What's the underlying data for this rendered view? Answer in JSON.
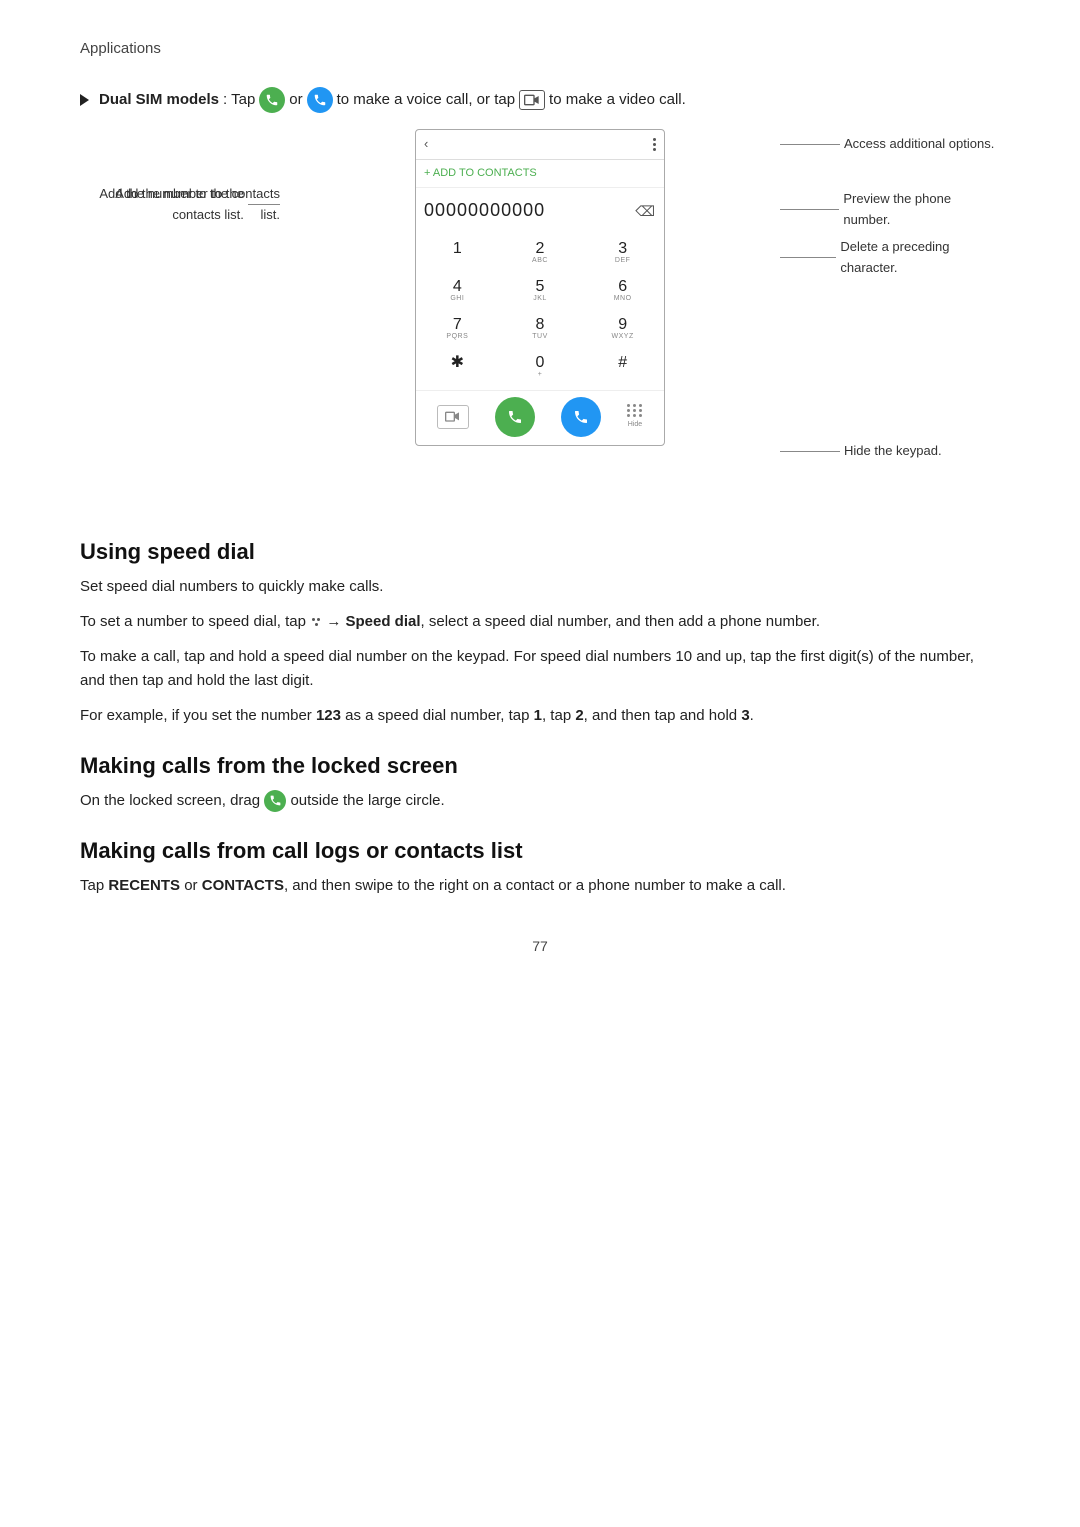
{
  "breadcrumb": "Applications",
  "dual_sim": {
    "label": "Dual SIM models",
    "text_before": ": Tap",
    "text_middle1": " or ",
    "text_middle2": " to make a voice call, or tap ",
    "text_end": " to make a video call."
  },
  "phone_ui": {
    "back_symbol": "‹",
    "menu_label": "⋮",
    "add_to_contacts_label": "+ ADD TO CONTACTS",
    "number_display": "00000000000",
    "keypad": [
      {
        "row": [
          {
            "num": "1",
            "sub": ""
          },
          {
            "num": "2",
            "sub": "ABC"
          },
          {
            "num": "3",
            "sub": "DEF"
          }
        ]
      },
      {
        "row": [
          {
            "num": "4",
            "sub": "GHI"
          },
          {
            "num": "5",
            "sub": "JKL"
          },
          {
            "num": "6",
            "sub": "MNO"
          }
        ]
      },
      {
        "row": [
          {
            "num": "7",
            "sub": "PQRS"
          },
          {
            "num": "8",
            "sub": "TUV"
          },
          {
            "num": "9",
            "sub": "WXYZ"
          }
        ]
      },
      {
        "row": [
          {
            "num": "✱",
            "sub": ""
          },
          {
            "num": "0",
            "sub": "+"
          },
          {
            "num": "#",
            "sub": ""
          }
        ]
      }
    ],
    "hide_label": "Hide"
  },
  "annotations": {
    "left_add_contacts": "Add the number to the contacts list.",
    "right_options": "Access additional options.",
    "right_preview": "Preview the phone number.",
    "right_delete": "Delete a preceding character.",
    "right_hide": "Hide the keypad."
  },
  "sections": [
    {
      "id": "speed-dial",
      "heading": "Using speed dial",
      "paragraphs": [
        "Set speed dial numbers to quickly make calls.",
        "To set a number to speed dial, tap  → Speed dial, select a speed dial number, and then add a phone number.",
        "To make a call, tap and hold a speed dial number on the keypad. For speed dial numbers 10 and up, tap the first digit(s) of the number, and then tap and hold the last digit.",
        "For example, if you set the number 123 as a speed dial number, tap 1, tap 2, and then tap and hold 3."
      ]
    },
    {
      "id": "locked-screen",
      "heading": "Making calls from the locked screen",
      "paragraphs": [
        "On the locked screen, drag  outside the large circle."
      ]
    },
    {
      "id": "call-logs",
      "heading": "Making calls from call logs or contacts list",
      "paragraphs": [
        "Tap RECENTS or CONTACTS, and then swipe to the right on a contact or a phone number to make a call."
      ]
    }
  ],
  "page_number": "77"
}
